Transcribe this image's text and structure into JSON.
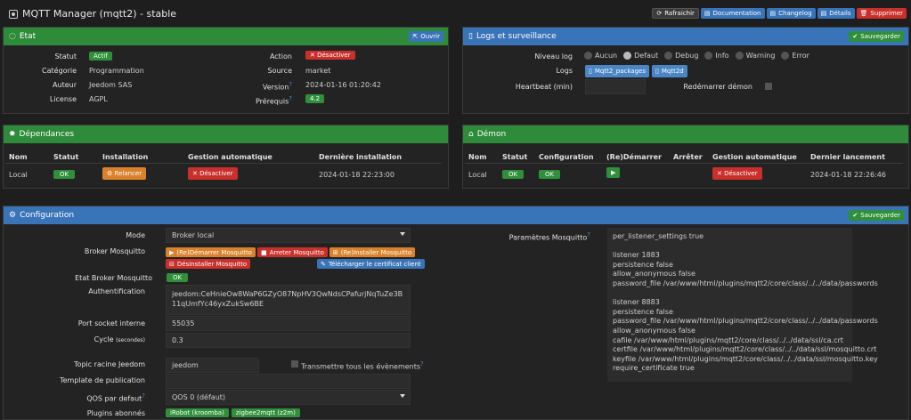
{
  "header": {
    "title": "MQTT Manager (mqtt2) - stable",
    "buttons": {
      "refresh": "Rafraichir",
      "docs": "Documentation",
      "changelog": "Changelog",
      "details": "Détails",
      "delete": "Supprimer"
    }
  },
  "etat": {
    "title": "Etat",
    "open_btn": "Ouvrir",
    "statut_label": "Statut",
    "statut_value": "Actif",
    "categorie_label": "Catégorie",
    "categorie_value": "Programmation",
    "auteur_label": "Auteur",
    "auteur_value": "Jeedom SAS",
    "licence_label": "License",
    "licence_value": "AGPL",
    "action_label": "Action",
    "action_value": "Désactiver",
    "source_label": "Source",
    "source_value": "market",
    "version_label": "Version",
    "version_value": "2024-01-16 01:20:42",
    "prereq_label": "Prérequis",
    "prereq_value": "4.2"
  },
  "logs": {
    "title": "Logs et surveillance",
    "save_btn": "Sauvegarder",
    "level_label": "Niveau log",
    "levels": [
      "Aucun",
      "Defaut",
      "Debug",
      "Info",
      "Warning",
      "Error"
    ],
    "logs_label": "Logs",
    "log_btn_1": "Mqtt2_packages",
    "log_btn_2": "Mqtt2d",
    "heartbeat_label": "Heartbeat (min)",
    "restart_label": "Redémarrer démon"
  },
  "deps": {
    "title": "Dépendances",
    "cols": [
      "Nom",
      "Statut",
      "Installation",
      "Gestion automatique",
      "Dernière installation"
    ],
    "row": {
      "nom": "Local",
      "statut": "OK",
      "installation": "Relancer",
      "gestion": "Désactiver",
      "derniere": "2024-01-18 22:23:00"
    }
  },
  "demon": {
    "title": "Démon",
    "cols": [
      "Nom",
      "Statut",
      "Configuration",
      "(Re)Démarrer",
      "Arrêter",
      "Gestion automatique",
      "Dernier lancement"
    ],
    "row": {
      "nom": "Local",
      "statut": "OK",
      "config": "OK",
      "gestion": "Désactiver",
      "dernier": "2024-01-18 22:26:46"
    }
  },
  "config": {
    "title": "Configuration",
    "save_btn": "Sauvegarder",
    "mode_label": "Mode",
    "mode_value": "Broker local",
    "broker_label": "Broker Mosquitto",
    "broker_btns": {
      "restart": "(Re)Démarrer Mosquitto",
      "stop": "Arreter Mosquitto",
      "install": "(Re)Installer Mosquitto",
      "uninstall": "Désinstaller Mosquitto",
      "download": "Télécharger le certificat client"
    },
    "etat_broker_label": "Etat Broker Mosquitto",
    "etat_broker_value": "OK",
    "auth_label": "Authentification",
    "auth_value": "jeedom:CeHnieOw8WaP6GZyO87NpHV3QwNdsCPafurjNqTuZe3B11qUmfYc46yxZukSw6BE",
    "port_label": "Port socket interne",
    "port_value": "55035",
    "cycle_label": "Cycle",
    "cycle_unit": "(secondes)",
    "cycle_value": "0.3",
    "topic_label": "Topic racine Jeedom",
    "topic_value": "jeedom",
    "transmit_label": "Transmettre tous les évènements",
    "template_label": "Template de publication",
    "qos_label": "QOS par defaut",
    "qos_value": "QOS 0 (défaut)",
    "plugins_label": "Plugins abonnés",
    "plugins": [
      "iRobot (kroomba)",
      "zigbee2mqtt (z2m)"
    ],
    "params_label": "Paramètres Mosquitto",
    "params_text": "per_listener_settings true\n\nlistener 1883\npersistence false\nallow_anonymous false\npassword_file /var/www/html/plugins/mqtt2/core/class/../../data/passwords\n\nlistener 8883\npersistence false\npassword_file /var/www/html/plugins/mqtt2/core/class/../../data/passwords\nallow_anonymous false\ncafile /var/www/html/plugins/mqtt2/core/class/../../data/ssl/ca.crt\ncertfile /var/www/html/plugins/mqtt2/core/class/../../data/ssl/mosquitto.crt\nkeyfile /var/www/html/plugins/mqtt2/core/class/../../data/ssl/mosquitto.key\nrequire_certificate true"
  }
}
